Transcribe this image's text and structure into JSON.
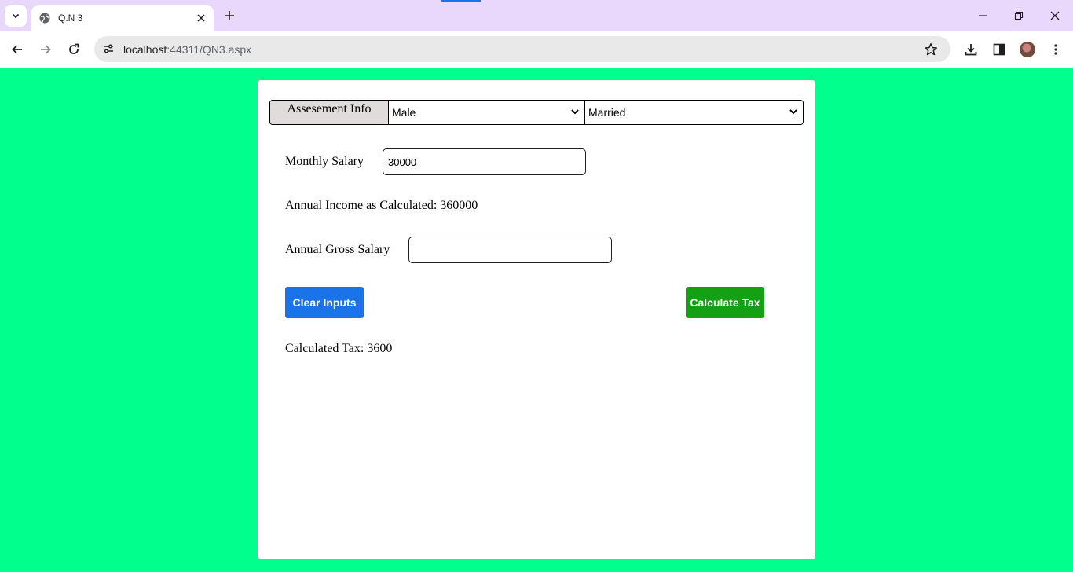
{
  "browser": {
    "tab_title": "Q.N 3",
    "url_host": "localhost",
    "url_path": ":44311/QN3.aspx"
  },
  "page": {
    "background_color": "#00ff8c",
    "assessment_label": "Assesement Info",
    "gender_select": {
      "selected": "Male"
    },
    "marital_select": {
      "selected": "Married"
    },
    "monthly_salary_label": "Monthly Salary",
    "monthly_salary_value": "30000",
    "annual_income_text": "Annual Income as Calculated: 360000",
    "annual_gross_label": "Annual Gross Salary",
    "annual_gross_value": "",
    "clear_button": "Clear Inputs",
    "calculate_button": "Calculate Tax",
    "calculated_tax_text": "Calculated Tax: 3600",
    "colors": {
      "clear_button": "#1a73e8",
      "calculate_button": "#14a014",
      "header_label_bg": "#e0dcdc"
    }
  }
}
